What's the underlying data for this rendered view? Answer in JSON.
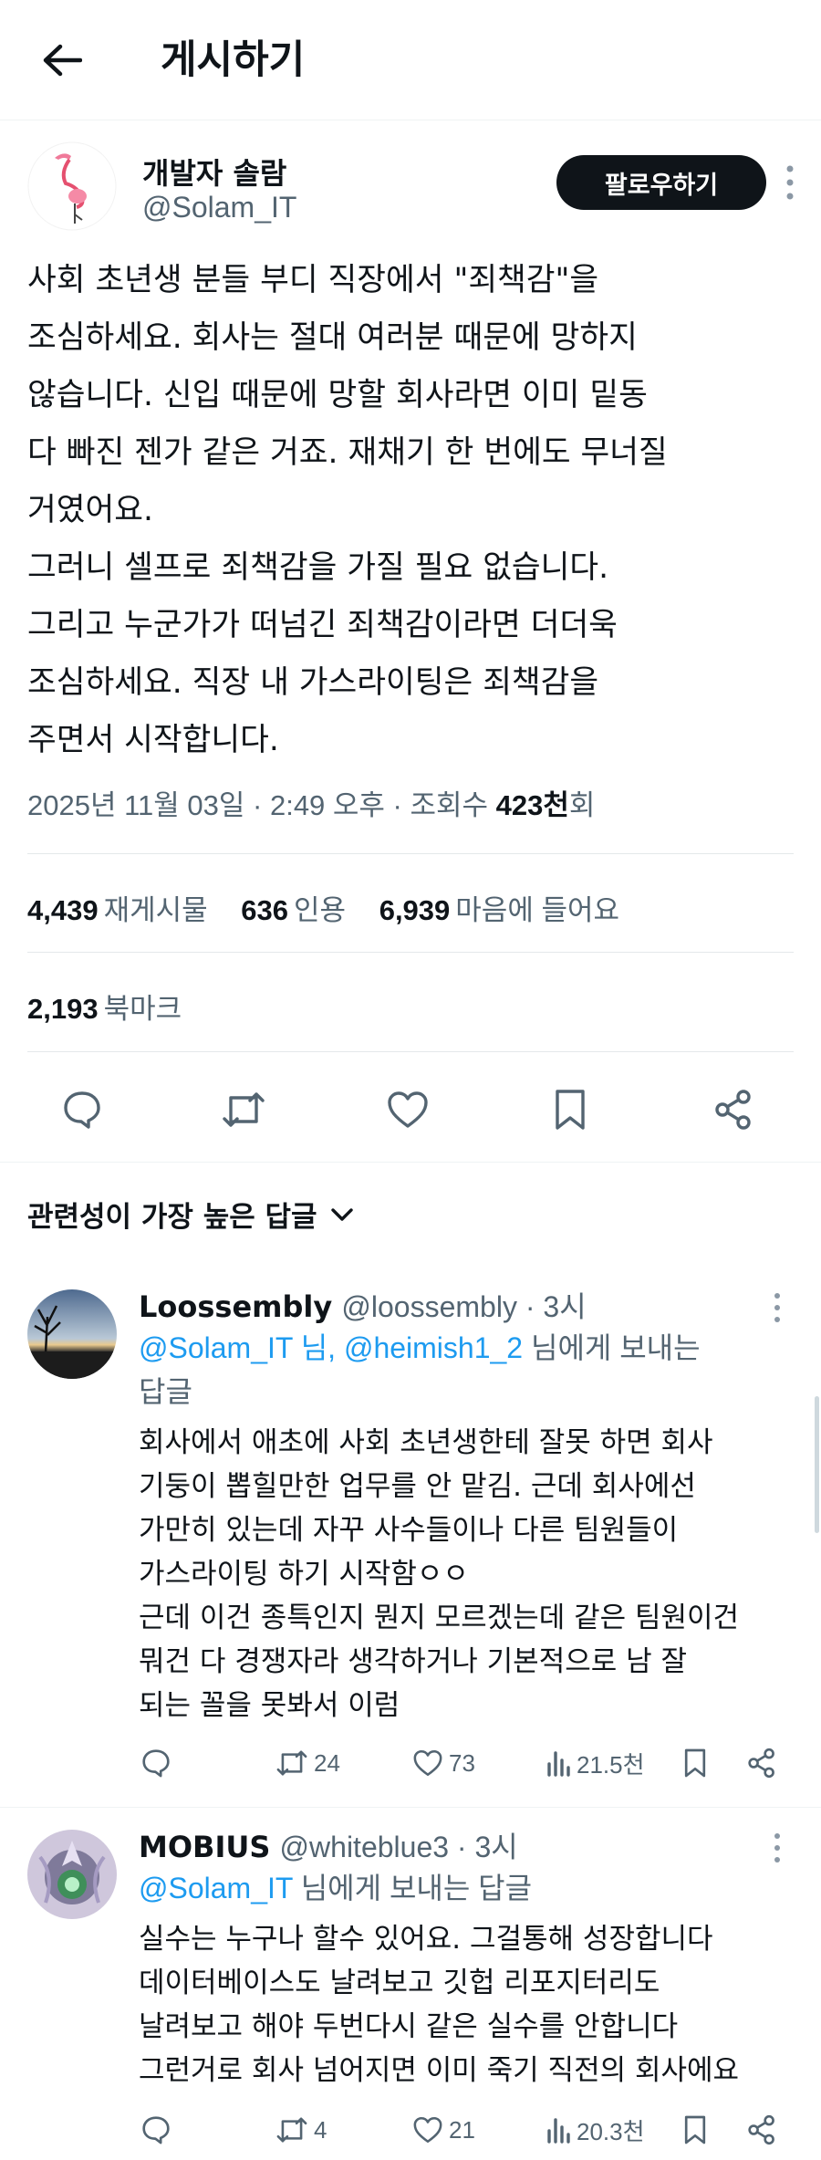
{
  "header": {
    "title": "게시하기"
  },
  "post": {
    "author_name": "개발자 솔람",
    "author_handle": "@Solam_IT",
    "follow_label": "팔로우하기",
    "body": "사회 초년생 분들 부디 직장에서 \"죄책감\"을\n조심하세요. 회사는 절대 여러분 때문에 망하지\n않습니다. 신입 때문에 망할 회사라면 이미 밑동\n다 빠진 젠가 같은 거죠. 재채기 한 번에도 무너질\n거였어요.\n그러니 셀프로 죄책감을 가질 필요 없습니다.\n그리고 누군가가 떠넘긴 죄책감이라면 더더욱\n조심하세요. 직장 내 가스라이팅은 죄책감을\n주면서 시작합니다.",
    "date": "2025년 11월 03일 · 2:49 오후 · 조회수 ",
    "views": "423천",
    "views_suffix": "회",
    "reposts": "4,439",
    "reposts_label": "재게시물",
    "quotes": "636",
    "quotes_label": "인용",
    "likes": "6,939",
    "likes_label": "마음에 들어요",
    "bookmarks": "2,193",
    "bookmarks_label": "북마크"
  },
  "sort": {
    "label": "관련성이 가장 높은 답글"
  },
  "replies": [
    {
      "name": "Loossembly",
      "handle": "@loossembly · 3시",
      "mention1": "@Solam_IT 님, @heimish1_2",
      "to_suffix": " 님에게 보내는",
      "to_tail": "답글",
      "text": "회사에서 애초에 사회 초년생한테 잘못 하면 회사\n기둥이 뽑힐만한 업무를 안 맡김. 근데 회사에선\n가만히 있는데 자꾸 사수들이나 다른 팀원들이\n가스라이팅 하기 시작함ㅇㅇ\n근데 이건 종특인지 뭔지 모르겠는데 같은 팀원이건\n뭐건 다 경쟁자라 생각하거나 기본적으로 남 잘\n되는 꼴을 못봐서 이럼",
      "reposts": "24",
      "likes": "73",
      "views": "21.5천"
    },
    {
      "name": "MOBIUS",
      "handle": "@whiteblue3 · 3시",
      "mention1": "@Solam_IT",
      "to_suffix": " 님에게 보내는 답글",
      "to_tail": "",
      "text": "실수는 누구나 할수 있어요. 그걸통해 성장합니다\n데이터베이스도 날려보고 깃헙 리포지터리도\n날려보고 해야 두번다시 같은 실수를 안합니다\n그런거로 회사 넘어지면 이미 죽기 직전의 회사에요",
      "reposts": "4",
      "likes": "21",
      "views": "20.3천"
    }
  ],
  "colors": {
    "link": "#1d9bf0",
    "secondary": "#536471",
    "primary": "#0f1419"
  }
}
